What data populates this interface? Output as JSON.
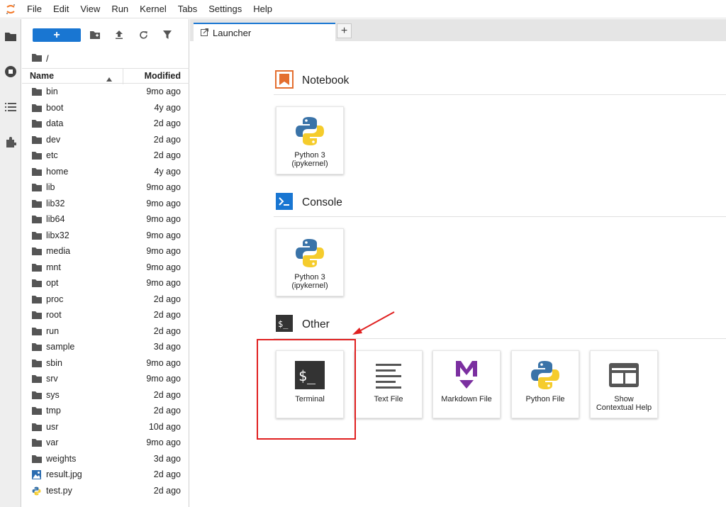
{
  "menubar": {
    "items": [
      "File",
      "Edit",
      "View",
      "Run",
      "Kernel",
      "Tabs",
      "Settings",
      "Help"
    ]
  },
  "activitybar": {
    "icons": [
      "folder-icon",
      "running-icon",
      "toc-icon",
      "extension-icon"
    ]
  },
  "filebrowser": {
    "new_label": "+",
    "breadcrumb": "/",
    "columns": {
      "name": "Name",
      "modified": "Modified"
    },
    "files": [
      {
        "name": "bin",
        "modified": "9mo ago",
        "type": "folder"
      },
      {
        "name": "boot",
        "modified": "4y ago",
        "type": "folder"
      },
      {
        "name": "data",
        "modified": "2d ago",
        "type": "folder"
      },
      {
        "name": "dev",
        "modified": "2d ago",
        "type": "folder"
      },
      {
        "name": "etc",
        "modified": "2d ago",
        "type": "folder"
      },
      {
        "name": "home",
        "modified": "4y ago",
        "type": "folder"
      },
      {
        "name": "lib",
        "modified": "9mo ago",
        "type": "folder"
      },
      {
        "name": "lib32",
        "modified": "9mo ago",
        "type": "folder"
      },
      {
        "name": "lib64",
        "modified": "9mo ago",
        "type": "folder"
      },
      {
        "name": "libx32",
        "modified": "9mo ago",
        "type": "folder"
      },
      {
        "name": "media",
        "modified": "9mo ago",
        "type": "folder"
      },
      {
        "name": "mnt",
        "modified": "9mo ago",
        "type": "folder"
      },
      {
        "name": "opt",
        "modified": "9mo ago",
        "type": "folder"
      },
      {
        "name": "proc",
        "modified": "2d ago",
        "type": "folder"
      },
      {
        "name": "root",
        "modified": "2d ago",
        "type": "folder"
      },
      {
        "name": "run",
        "modified": "2d ago",
        "type": "folder"
      },
      {
        "name": "sample",
        "modified": "3d ago",
        "type": "folder"
      },
      {
        "name": "sbin",
        "modified": "9mo ago",
        "type": "folder"
      },
      {
        "name": "srv",
        "modified": "9mo ago",
        "type": "folder"
      },
      {
        "name": "sys",
        "modified": "2d ago",
        "type": "folder"
      },
      {
        "name": "tmp",
        "modified": "2d ago",
        "type": "folder"
      },
      {
        "name": "usr",
        "modified": "10d ago",
        "type": "folder"
      },
      {
        "name": "var",
        "modified": "9mo ago",
        "type": "folder"
      },
      {
        "name": "weights",
        "modified": "3d ago",
        "type": "folder"
      },
      {
        "name": "result.jpg",
        "modified": "2d ago",
        "type": "image"
      },
      {
        "name": "test.py",
        "modified": "2d ago",
        "type": "python"
      }
    ]
  },
  "tabs": [
    {
      "label": "Launcher",
      "add_label": "+"
    }
  ],
  "launcher": {
    "sections": [
      {
        "title": "Notebook",
        "cards": [
          {
            "label": "Python 3\n(ipykernel)",
            "icon": "python-icon"
          }
        ]
      },
      {
        "title": "Console",
        "cards": [
          {
            "label": "Python 3\n(ipykernel)",
            "icon": "python-icon"
          }
        ]
      },
      {
        "title": "Other",
        "cards": [
          {
            "label": "Terminal",
            "icon": "terminal-icon"
          },
          {
            "label": "Text File",
            "icon": "text-file-icon"
          },
          {
            "label": "Markdown File",
            "icon": "markdown-icon"
          },
          {
            "label": "Python File",
            "icon": "python-icon"
          },
          {
            "label": "Show\nContextual Help",
            "icon": "contextual-help-icon"
          }
        ]
      }
    ]
  },
  "colors": {
    "accent": "#1976d2",
    "notebook": "#e46e2e",
    "console": "#1976d2",
    "other": "#333333",
    "markdown": "#7b2fa0",
    "highlight": "#e02020"
  }
}
